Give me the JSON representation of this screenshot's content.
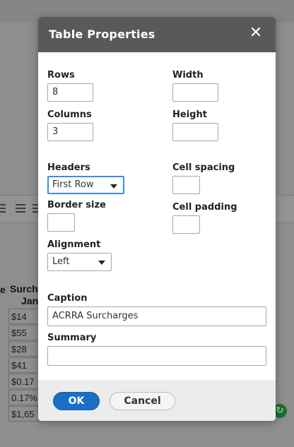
{
  "background": {
    "table": {
      "header_left_fragment": "e",
      "header_lines": [
        "Surch",
        "Jan"
      ],
      "cells": [
        "$14",
        "$55",
        "$28",
        "$41",
        "$0.17",
        "0.17%",
        "$1,65"
      ]
    },
    "status_icon": "circle-status-icon"
  },
  "dialog": {
    "title": "Table Properties",
    "close_glyph": "✕",
    "fields": {
      "rows": {
        "label": "Rows",
        "value": "8"
      },
      "columns": {
        "label": "Columns",
        "value": "3"
      },
      "width": {
        "label": "Width",
        "value": ""
      },
      "height": {
        "label": "Height",
        "value": ""
      },
      "headers": {
        "label": "Headers",
        "value": "First Row"
      },
      "cell_spacing": {
        "label": "Cell spacing",
        "value": ""
      },
      "border_size": {
        "label": "Border size",
        "value": ""
      },
      "cell_padding": {
        "label": "Cell padding",
        "value": ""
      },
      "alignment": {
        "label": "Alignment",
        "value": "Left"
      },
      "caption": {
        "label": "Caption",
        "value": "ACRRA Surcharges"
      },
      "summary": {
        "label": "Summary",
        "value": ""
      }
    },
    "buttons": {
      "ok": "OK",
      "cancel": "Cancel"
    }
  },
  "colors": {
    "header_bg": "#595959",
    "ok_button": "#1a6fc4",
    "focus_ring": "#3a8ee6",
    "overlay": "#8e8e8e"
  }
}
